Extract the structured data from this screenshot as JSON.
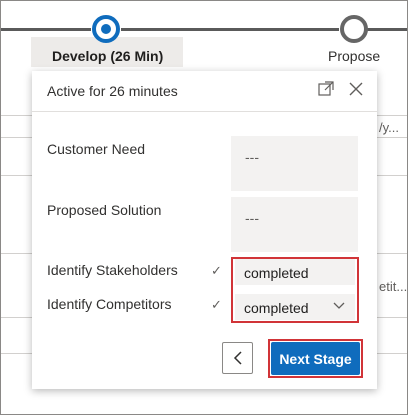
{
  "stages": {
    "active_label": "Develop  (26 Min)",
    "next_label": "Propose"
  },
  "background": {
    "fragment_top": "/y...",
    "fragment_mid": "etit..."
  },
  "flyout": {
    "title": "Active for 26 minutes",
    "fields": {
      "customer_need": {
        "label": "Customer Need",
        "value": "---"
      },
      "proposed_solution": {
        "label": "Proposed Solution",
        "value": "---"
      },
      "identify_stakeholders": {
        "label": "Identify Stakeholders",
        "check": "✓",
        "value": "completed"
      },
      "identify_competitors": {
        "label": "Identify Competitors",
        "check": "✓",
        "value": "completed"
      }
    },
    "next_stage_label": "Next Stage"
  },
  "colors": {
    "accent": "#0f6cbd",
    "highlight": "#d13438",
    "field_bg": "#f3f2f1"
  }
}
